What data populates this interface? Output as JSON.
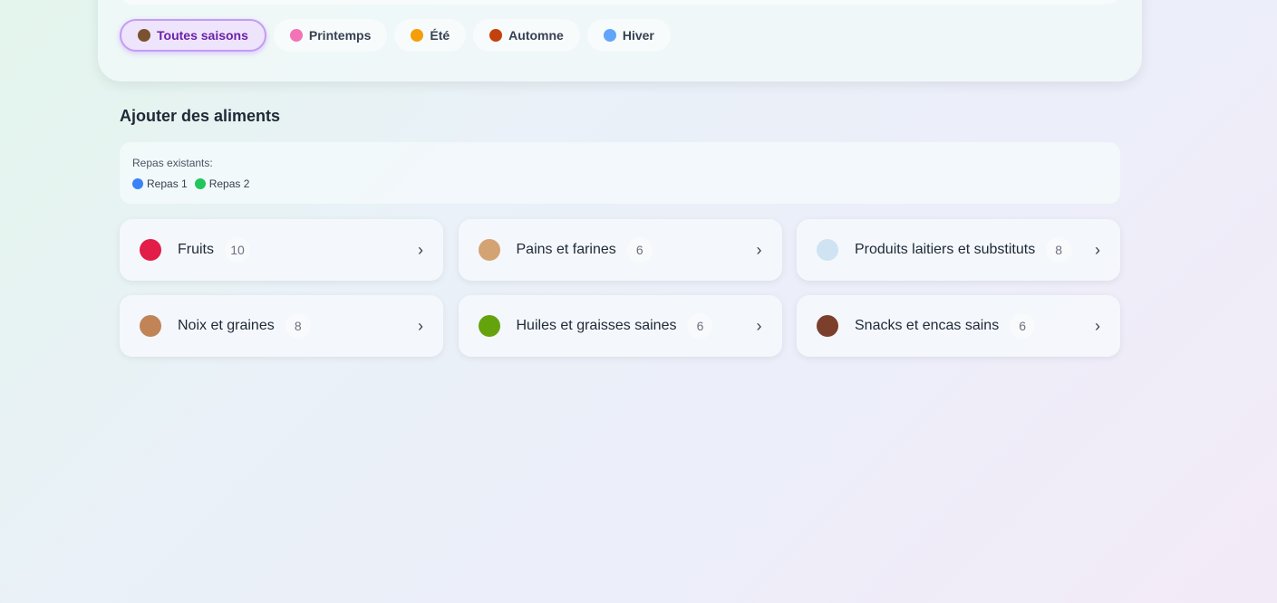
{
  "seasons": [
    {
      "label": "Toutes saisons",
      "icon": "seedling-icon",
      "color": "#7a5230",
      "active": true
    },
    {
      "label": "Printemps",
      "icon": "flower-icon",
      "color": "#f472b6",
      "active": false
    },
    {
      "label": "Été",
      "icon": "sun-icon",
      "color": "#f59e0b",
      "active": false
    },
    {
      "label": "Automne",
      "icon": "leaf-icon",
      "color": "#c2410c",
      "active": false
    },
    {
      "label": "Hiver",
      "icon": "snowflake-icon",
      "color": "#60a5fa",
      "active": false
    }
  ],
  "section_title": "Ajouter des aliments",
  "meals": {
    "label": "Repas existants:",
    "items": [
      {
        "label": "Repas 1",
        "color": "#3b82f6"
      },
      {
        "label": "Repas 2",
        "color": "#22c55e"
      }
    ]
  },
  "categories": [
    {
      "name": "Fruits",
      "count": "10",
      "icon": "apple-icon",
      "color": "#e11d48"
    },
    {
      "name": "Pains et farines",
      "count": "6",
      "icon": "bread-icon",
      "color": "#d4a373"
    },
    {
      "name": "Produits laitiers et substituts",
      "count": "8",
      "icon": "milk-glass-icon",
      "color": "#cfe3f3"
    },
    {
      "name": "Noix et graines",
      "count": "8",
      "icon": "peanut-icon",
      "color": "#c08457"
    },
    {
      "name": "Huiles et graisses saines",
      "count": "6",
      "icon": "olive-icon",
      "color": "#65a30d"
    },
    {
      "name": "Snacks et encas sains",
      "count": "6",
      "icon": "chocolate-icon",
      "color": "#7c3f2c"
    }
  ]
}
